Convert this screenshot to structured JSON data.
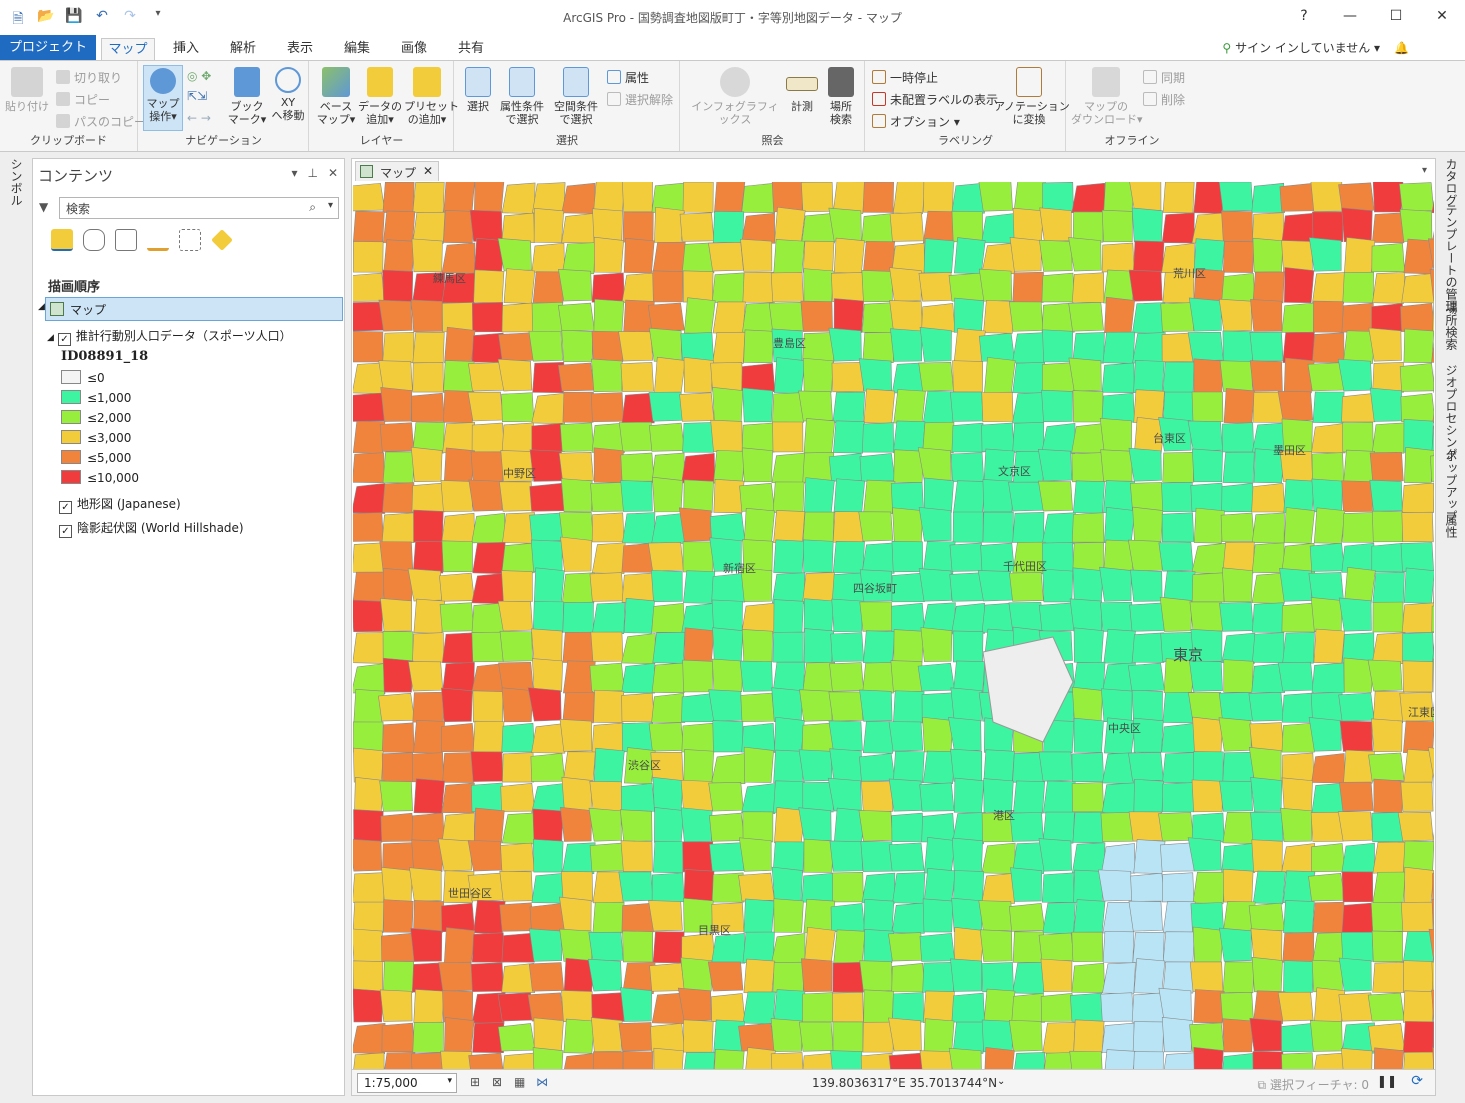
{
  "app": {
    "title": "ArcGIS Pro - 国勢調査地図版町丁・字等別地図データ - マップ"
  },
  "window": {
    "help": "?",
    "min": "—",
    "max": "☐",
    "close": "✕"
  },
  "tabs": {
    "project": "プロジェクト",
    "items": [
      "マップ",
      "挿入",
      "解析",
      "表示",
      "編集",
      "画像",
      "共有"
    ]
  },
  "signin": "サイン インしていません ▾",
  "ribbon": {
    "clipboard": {
      "label": "クリップボード",
      "paste": "貼り付け",
      "cut": "切り取り",
      "copy": "コピー",
      "copy_path": "パスのコピー"
    },
    "navigation": {
      "label": "ナビゲーション",
      "explore": "マップ\n操作▾",
      "bookmarks": "ブック\nマーク▾",
      "goto_xy": "XY\nへ移動"
    },
    "layer": {
      "label": "レイヤー",
      "basemap": "ベース\nマップ▾",
      "add_data": "データの\n追加▾",
      "add_preset": "プリセット\nの追加▾"
    },
    "selection": {
      "label": "選択",
      "select": "選択",
      "by_attr": "属性条件\nで選択",
      "by_loc": "空間条件\nで選択",
      "attributes": "属性",
      "clear": "選択解除"
    },
    "inquiry": {
      "label": "照会",
      "infographics": "インフォグラフィックス",
      "measure": "計測",
      "locate": "場所\n検索"
    },
    "labeling": {
      "label": "ラベリング",
      "pause": "一時停止",
      "unplaced": "未配置ラベルの表示",
      "options": "オプション ▾",
      "convert": "アノテーション\nに変換"
    },
    "offline": {
      "label": "オフライン",
      "download": "マップの\nダウンロード▾",
      "sync": "同期",
      "remove": "削除"
    }
  },
  "left_tab": "シンボル",
  "contents": {
    "title": "コンテンツ",
    "search_placeholder": "検索",
    "draw_order": "描画順序",
    "map_node": "マップ",
    "layer1": "推計行動別人口データ（スポーツ人口）",
    "field": "ID08891_18",
    "legend": [
      {
        "label": "≤0",
        "color": "#f4f4f4"
      },
      {
        "label": "≤1,000",
        "color": "#3df5a0"
      },
      {
        "label": "≤2,000",
        "color": "#98ee3c"
      },
      {
        "label": "≤3,000",
        "color": "#f3cc3c"
      },
      {
        "label": "≤5,000",
        "color": "#f0843c"
      },
      {
        "label": "≤10,000",
        "color": "#f03c3c"
      }
    ],
    "layer2": "地形図 (Japanese)",
    "layer3": "陰影起伏図 (World Hillshade)"
  },
  "map": {
    "tab": "マップ",
    "scale": "1:75,000",
    "coords": "139.8036317°E 35.7013744°N",
    "selected_features": "選択フィーチャ: 0",
    "labels": [
      "練馬区",
      "豊島区",
      "荒川区",
      "中野区",
      "文京区",
      "台東区",
      "墨田区",
      "新宿区",
      "千代田区",
      "四谷坂町",
      "東京",
      "中央区",
      "渋谷区",
      "港区",
      "江東区",
      "世田谷区",
      "目黒区"
    ]
  },
  "right_tabs": [
    "カタログ",
    "テンプレートの管理",
    "場所検索",
    "ジオプロセシング",
    "ポップアップ",
    "属性"
  ]
}
